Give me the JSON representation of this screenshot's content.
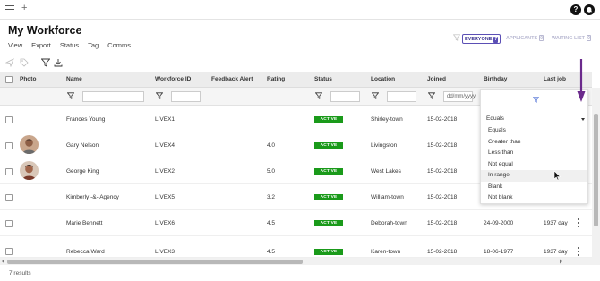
{
  "app": {
    "title": "My Workforce",
    "menu": [
      "View",
      "Export",
      "Status",
      "Tag",
      "Comms"
    ],
    "help_label": "?"
  },
  "modes": [
    {
      "label": "EVERYONE",
      "count": "7",
      "active": true
    },
    {
      "label": "APPLICANTS",
      "count": "0",
      "active": false
    },
    {
      "label": "WAITING LIST",
      "count": "0",
      "active": false
    }
  ],
  "columns": [
    "Photo",
    "Name",
    "Workforce ID",
    "Feedback Alert",
    "Rating",
    "Status",
    "Location",
    "Joined",
    "Birthday",
    "Last job"
  ],
  "filters": {
    "joined_placeholder": "dd/mm/yyyy"
  },
  "rows": [
    {
      "name": "Frances Young",
      "id": "LIVEX1",
      "rating": "",
      "status": "ACTIVE",
      "location": "Shirley-town",
      "joined": "15-02-2018",
      "birthday": "",
      "last_job": "",
      "photo": "none",
      "menu": false
    },
    {
      "name": "Gary Nelson",
      "id": "LIVEX4",
      "rating": "4.0",
      "status": "ACTIVE",
      "location": "Livingston",
      "joined": "15-02-2018",
      "birthday": "",
      "last_job": "",
      "photo": "avatar1",
      "menu": false
    },
    {
      "name": "George King",
      "id": "LIVEX2",
      "rating": "5.0",
      "status": "ACTIVE",
      "location": "West Lakes",
      "joined": "15-02-2018",
      "birthday": "",
      "last_job": "",
      "photo": "avatar2",
      "menu": false
    },
    {
      "name": "Kimberly -&- Agency",
      "id": "LIVEX5",
      "rating": "3.2",
      "status": "ACTIVE",
      "location": "William-town",
      "joined": "15-02-2018",
      "birthday": "",
      "last_job": "",
      "photo": "none",
      "menu": false
    },
    {
      "name": "Marie Bennett",
      "id": "LIVEX6",
      "rating": "4.5",
      "status": "ACTIVE",
      "location": "Deborah-town",
      "joined": "15-02-2018",
      "birthday": "24-09-2000",
      "last_job": "1937 day",
      "photo": "none",
      "menu": true
    },
    {
      "name": "Rebecca Ward",
      "id": "LIVEX3",
      "rating": "4.5",
      "status": "ACTIVE",
      "location": "Karen-town",
      "joined": "15-02-2018",
      "birthday": "18-06-1977",
      "last_job": "1937 day",
      "photo": "none",
      "menu": true
    }
  ],
  "filter_dropdown": {
    "selected": "Equals",
    "options": [
      "Equals",
      "Greater than",
      "Less than",
      "Not equal",
      "In range",
      "Blank",
      "Not blank"
    ],
    "hovered": "In range"
  },
  "footer": {
    "results": "7 results"
  },
  "colors": {
    "accent": "#5b4fb5",
    "active_badge": "#1a9a1a",
    "arrow": "#6b2a8c"
  }
}
